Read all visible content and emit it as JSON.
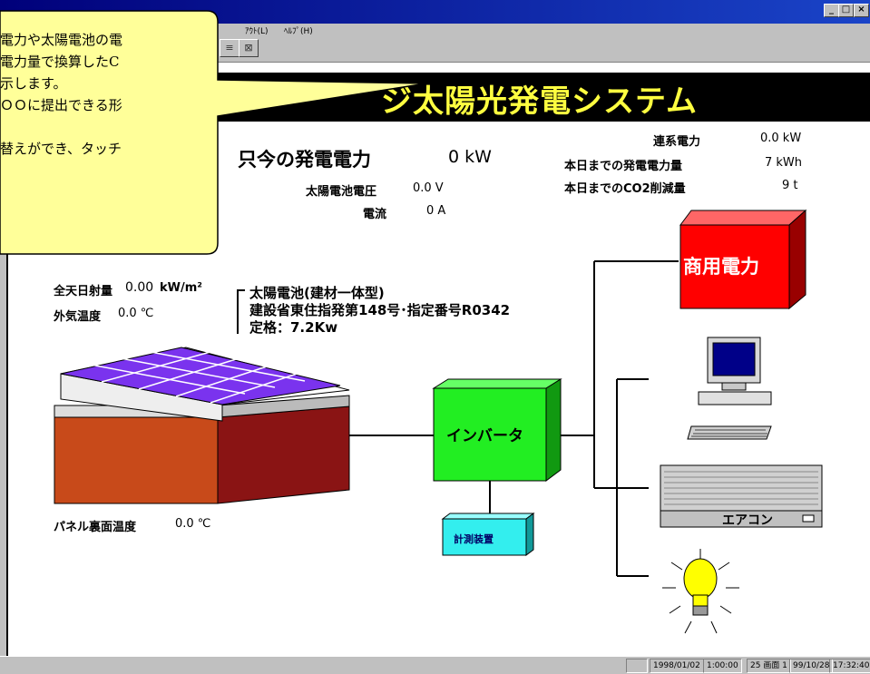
{
  "window": {
    "menu_visible": [
      "ｱｳﾄ(L)",
      "ﾍﾙﾌﾟ(H)"
    ],
    "title_buttons": [
      "_",
      "□",
      "×"
    ]
  },
  "banner": {
    "title": "ジ太陽光発電システム"
  },
  "readings": {
    "gen_power_label": "只今の発電電力",
    "gen_power_value": "0 kW",
    "voltage_label": "太陽電池電圧",
    "voltage_value": "0.0 V",
    "current_label": "電流",
    "current_value": "0 A",
    "grid_label": "連系電力",
    "grid_value": "0.0 kW",
    "energy_label": "本日までの発電電力量",
    "energy_value": "7 kWh",
    "co2_label": "本日までのCO2削減量",
    "co2_value": "9 t",
    "irradiance_label": "全天日射量",
    "irradiance_value": "0.00",
    "irradiance_unit": "kW/m²",
    "outdoor_label": "外気温度",
    "outdoor_value": "0.0 ℃",
    "panel_temp_label": "パネル裏面温度",
    "panel_temp_value": "0.0 ℃"
  },
  "solar": {
    "line1": "太陽電池(建材一体型)",
    "line2": "建設省東住指発第148号･指定番号R0342",
    "line3": "定格：7.2Kw"
  },
  "devices": {
    "inverter": "インバータ",
    "meter": "計測装置",
    "commercial": "商用電力",
    "aircon": "エアコン"
  },
  "balloon": {
    "lines": [
      "電力や太陽電池の電",
      "電力量で換算したC",
      "示します。",
      "ＯＯに提出できる形",
      "",
      "替えができ、タッチ"
    ]
  },
  "status": {
    "date": "1998/01/02",
    "time1": "1:00:00",
    "screen": "25 画面 1",
    "date2": "99/10/28",
    "time2": "17:32:40"
  },
  "colors": {
    "banner_text": "#ffff40",
    "commercial": "#ff0000",
    "inverter": "#22ee22",
    "meter": "#33eeee",
    "balloon": "#ffff99"
  }
}
